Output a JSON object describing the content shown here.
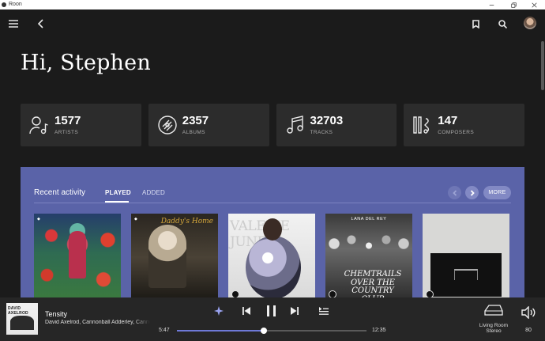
{
  "window": {
    "title": "Roon"
  },
  "greeting": "Hi, Stephen",
  "stats": [
    {
      "icon": "artist-icon",
      "value": "1577",
      "label": "ARTISTS"
    },
    {
      "icon": "album-disc-icon",
      "value": "2357",
      "label": "ALBUMS"
    },
    {
      "icon": "music-note-icon",
      "value": "32703",
      "label": "TRACKS"
    },
    {
      "icon": "composer-icon",
      "value": "147",
      "label": "COMPOSERS"
    }
  ],
  "recent": {
    "title": "Recent activity",
    "tabs": [
      "PLAYED",
      "ADDED"
    ],
    "active_tab": "PLAYED",
    "more_label": "MORE",
    "covers": [
      {
        "name": "album-cover-1"
      },
      {
        "name": "album-cover-daddys-home",
        "text": "Daddy's Home"
      },
      {
        "name": "album-cover-valerie-june",
        "text": "VALERIE JUNE"
      },
      {
        "name": "album-cover-chemtrails",
        "top": "LANA DEL REY",
        "text": "CHEMTRAILS OVER THE COUNTRY CLUB"
      },
      {
        "name": "album-cover-5"
      }
    ]
  },
  "player": {
    "album_art_text": "DAVID AXELROD",
    "track": "Tensity",
    "artist": "David Axelrod, Cannonball Adderley, Cannonball Adderley",
    "elapsed": "5:47",
    "duration": "12:35",
    "progress": 0.46,
    "zone": "Living Room Stereo",
    "zone_line1": "Living Room",
    "zone_line2": "Stereo",
    "volume": "80"
  }
}
